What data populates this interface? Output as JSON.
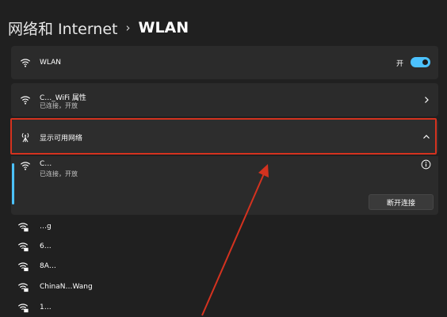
{
  "breadcrumb": {
    "parent": "网络和 Internet",
    "separator": "›",
    "current": "WLAN"
  },
  "wlan": {
    "label": "WLAN",
    "toggle_label": "开",
    "toggle_on": true
  },
  "properties": {
    "title": "C…_WiFi 属性",
    "status": "已连接，开放"
  },
  "available": {
    "label": "显示可用网络",
    "expanded": true
  },
  "connected": {
    "name": "C…",
    "status": "已连接，开放",
    "disconnect_label": "断开连接"
  },
  "networks": [
    {
      "name": "…g"
    },
    {
      "name": "6…"
    },
    {
      "name": "8A…"
    },
    {
      "name": "ChinaN…Wang"
    },
    {
      "name": "1…"
    }
  ],
  "colors": {
    "accent": "#4cc2ff",
    "highlight": "#d4321f",
    "card": "#2b2b2b",
    "background": "#202020"
  }
}
